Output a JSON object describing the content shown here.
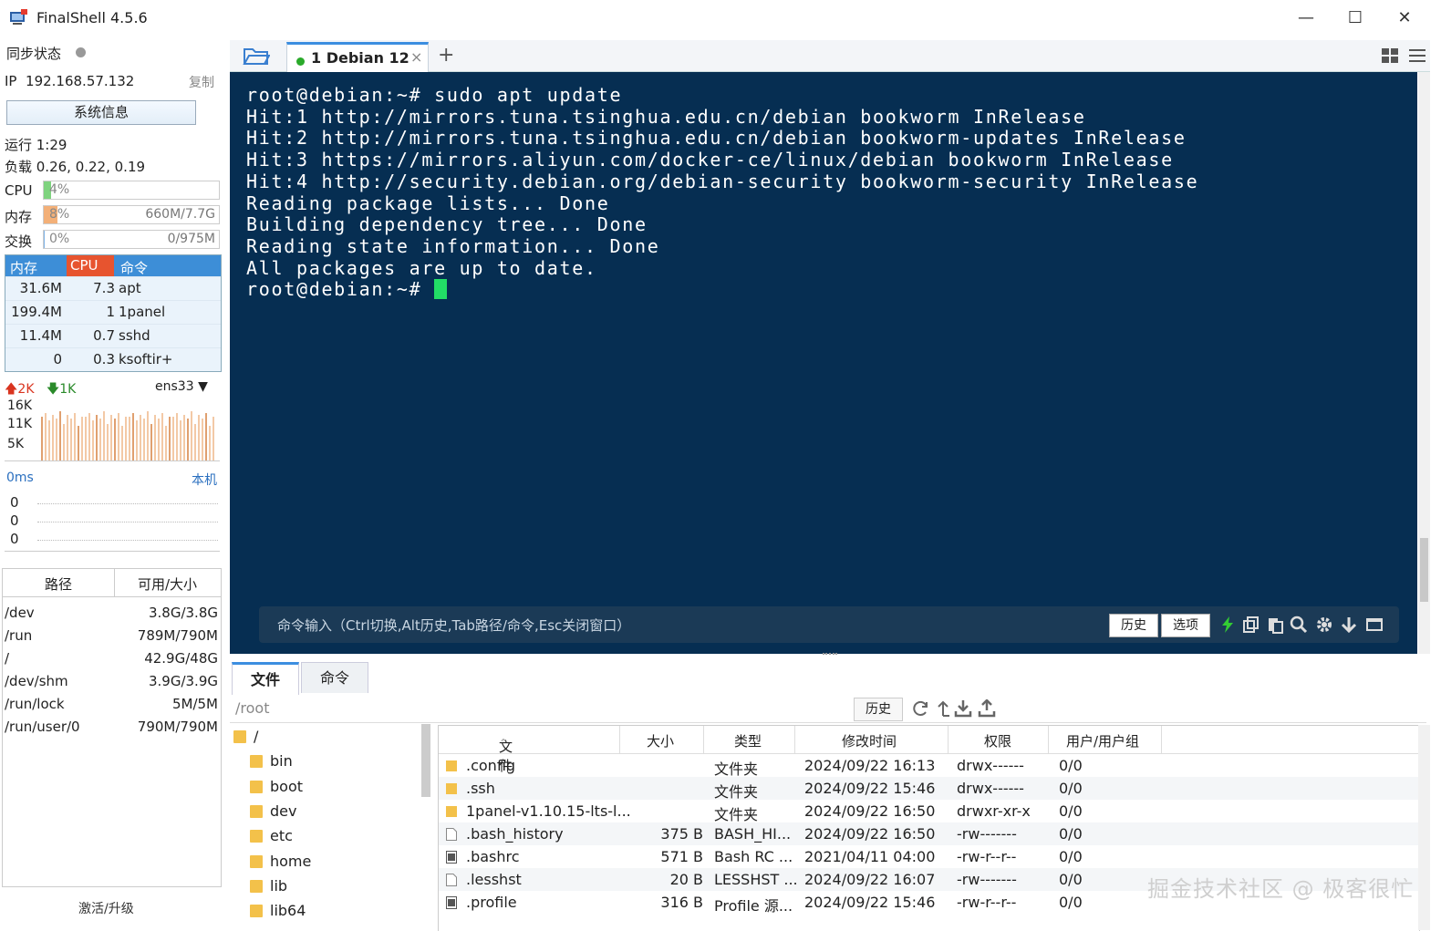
{
  "window": {
    "title": "FinalShell 4.5.6"
  },
  "sidebar": {
    "sync_label": "同步状态",
    "ip_label": "IP",
    "ip": "192.168.57.132",
    "copy": "复制",
    "sysinfo": "系统信息",
    "uptime": "运行 1:29",
    "load": "负载 0.26, 0.22, 0.19",
    "cpu": {
      "label": "CPU",
      "pct": "4%",
      "value": "",
      "fraction": 0.04
    },
    "mem": {
      "label": "内存",
      "pct": "8%",
      "value": "660M/7.7G",
      "fraction": 0.08
    },
    "swap": {
      "label": "交换",
      "pct": "0%",
      "value": "0/975M",
      "fraction": 0
    },
    "proc_headers": [
      "内存",
      "CPU",
      "命令"
    ],
    "procs": [
      {
        "mem": "31.6M",
        "cpu": "7.3",
        "cmd": "apt"
      },
      {
        "mem": "199.4M",
        "cpu": "1",
        "cmd": "1panel"
      },
      {
        "mem": "11.4M",
        "cpu": "0.7",
        "cmd": "sshd"
      },
      {
        "mem": "0",
        "cpu": "0.3",
        "cmd": "ksoftir+"
      }
    ],
    "net": {
      "up": "2K",
      "down": "1K",
      "iface": "ens33",
      "ticks": [
        "16K",
        "11K",
        "5K"
      ]
    },
    "latency": {
      "label": "0ms",
      "host": "本机",
      "values": [
        "0",
        "0",
        "0"
      ]
    },
    "disk_headers": [
      "路径",
      "可用/大小"
    ],
    "disks": [
      {
        "path": "/dev",
        "size": "3.8G/3.8G"
      },
      {
        "path": "/run",
        "size": "789M/790M"
      },
      {
        "path": "/",
        "size": "42.9G/48G"
      },
      {
        "path": "/dev/shm",
        "size": "3.9G/3.9G"
      },
      {
        "path": "/run/lock",
        "size": "5M/5M"
      },
      {
        "path": "/run/user/0",
        "size": "790M/790M"
      }
    ],
    "activate": "激活/升级"
  },
  "tabs": [
    {
      "label": "1  Debian 12",
      "close": "×"
    }
  ],
  "add_tab": "+",
  "terminal": {
    "lines": [
      "root@debian:~# sudo apt update",
      "Hit:1 http://mirrors.tuna.tsinghua.edu.cn/debian bookworm InRelease",
      "Hit:2 http://mirrors.tuna.tsinghua.edu.cn/debian bookworm-updates InRelease",
      "Hit:3 https://mirrors.aliyun.com/docker-ce/linux/debian bookworm InRelease",
      "Hit:4 http://security.debian.org/debian-security bookworm-security InRelease",
      "Reading package lists... Done",
      "Building dependency tree... Done",
      "Reading state information... Done",
      "All packages are up to date."
    ],
    "prompt": "root@debian:~# "
  },
  "cmdbar": {
    "placeholder": "命令输入（Ctrl切换,Alt历史,Tab路径/命令,Esc关闭窗口）",
    "history": "历史",
    "options": "选项"
  },
  "lower_tabs": [
    "文件",
    "命令"
  ],
  "file_panel": {
    "path": "/root",
    "history": "历史",
    "tree": [
      {
        "name": "/",
        "level": 0
      },
      {
        "name": "bin",
        "level": 1
      },
      {
        "name": "boot",
        "level": 1
      },
      {
        "name": "dev",
        "level": 1
      },
      {
        "name": "etc",
        "level": 1
      },
      {
        "name": "home",
        "level": 1
      },
      {
        "name": "lib",
        "level": 1
      },
      {
        "name": "lib64",
        "level": 1
      }
    ],
    "columns": [
      "文件名",
      "大小",
      "类型",
      "修改时间",
      "权限",
      "用户/用户组"
    ],
    "files": [
      {
        "name": ".config",
        "size": "",
        "type": "文件夹",
        "mtime": "2024/09/22 16:13",
        "perm": "drwx------",
        "owner": "0/0",
        "icon": "folder-icon"
      },
      {
        "name": ".ssh",
        "size": "",
        "type": "文件夹",
        "mtime": "2024/09/22 15:46",
        "perm": "drwx------",
        "owner": "0/0",
        "icon": "folder-icon"
      },
      {
        "name": "1panel-v1.10.15-lts-l...",
        "size": "",
        "type": "文件夹",
        "mtime": "2024/09/22 16:50",
        "perm": "drwxr-xr-x",
        "owner": "0/0",
        "icon": "folder-icon"
      },
      {
        "name": ".bash_history",
        "size": "375 B",
        "type": "BASH_HI...",
        "mtime": "2024/09/22 16:50",
        "perm": "-rw-------",
        "owner": "0/0",
        "icon": "file-icon"
      },
      {
        "name": ".bashrc",
        "size": "571 B",
        "type": "Bash RC ...",
        "mtime": "2021/04/11 04:00",
        "perm": "-rw-r--r--",
        "owner": "0/0",
        "icon": "config-file-icon"
      },
      {
        "name": ".lesshst",
        "size": "20 B",
        "type": "LESSHST ...",
        "mtime": "2024/09/22 16:07",
        "perm": "-rw-------",
        "owner": "0/0",
        "icon": "file-icon"
      },
      {
        "name": ".profile",
        "size": "316 B",
        "type": "Profile 源...",
        "mtime": "2024/09/22 15:46",
        "perm": "-rw-r--r--",
        "owner": "0/0",
        "icon": "config-file-icon"
      }
    ]
  },
  "watermark": "掘金技术社区 @ 极客很忙",
  "colors": {
    "terminal_bg": "#062e52",
    "accent": "#3c8ee0",
    "cursor": "#22dd66"
  }
}
